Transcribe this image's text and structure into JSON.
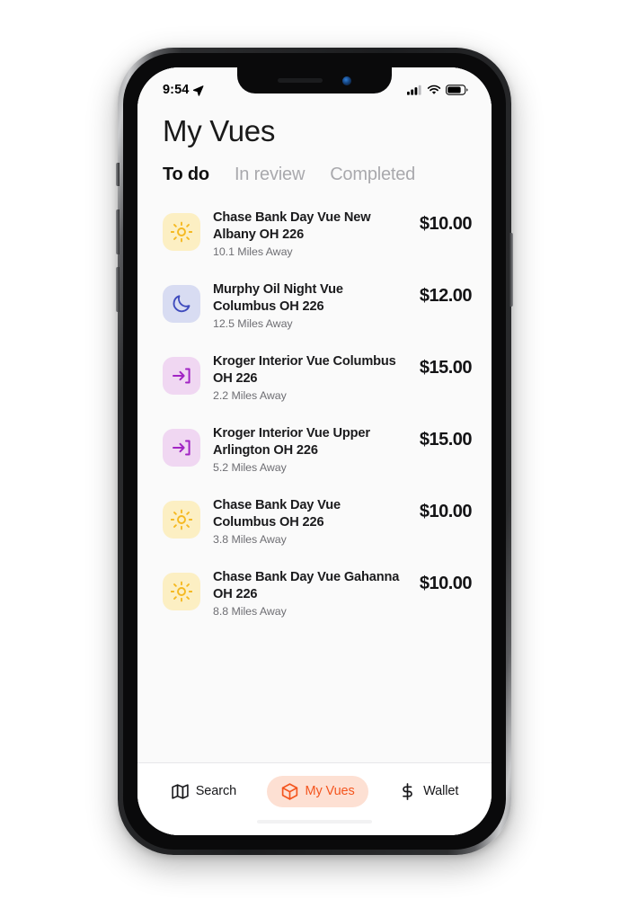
{
  "status_bar": {
    "time": "9:54",
    "location_icon": "location-arrow-icon",
    "cellular_icon": "cellular-bars-icon",
    "wifi_icon": "wifi-icon",
    "battery_icon": "battery-icon"
  },
  "header": {
    "title": "My Vues"
  },
  "tabs": [
    {
      "label": "To do",
      "active": true
    },
    {
      "label": "In review",
      "active": false
    },
    {
      "label": "Completed",
      "active": false
    }
  ],
  "list": {
    "items": [
      {
        "icon": "sun-icon",
        "icon_style": "sun",
        "title": "Chase Bank Day Vue New Albany OH 226",
        "distance": "10.1 Miles Away",
        "price": "$10.00"
      },
      {
        "icon": "moon-icon",
        "icon_style": "moon",
        "title": "Murphy Oil Night Vue Columbus OH 226",
        "distance": "12.5 Miles Away",
        "price": "$12.00"
      },
      {
        "icon": "enter-arrow-icon",
        "icon_style": "enter",
        "title": "Kroger Interior Vue Columbus OH 226",
        "distance": "2.2 Miles Away",
        "price": "$15.00"
      },
      {
        "icon": "enter-arrow-icon",
        "icon_style": "enter",
        "title": "Kroger Interior Vue Upper Arlington OH 226",
        "distance": "5.2 Miles Away",
        "price": "$15.00"
      },
      {
        "icon": "sun-icon",
        "icon_style": "sun",
        "title": "Chase Bank Day Vue Columbus OH 226",
        "distance": "3.8 Miles Away",
        "price": "$10.00"
      },
      {
        "icon": "sun-icon",
        "icon_style": "sun",
        "title": "Chase Bank Day Vue Gahanna OH 226",
        "distance": "8.8 Miles Away",
        "price": "$10.00"
      }
    ]
  },
  "bottom_nav": {
    "items": [
      {
        "label": "Search",
        "icon": "map-icon",
        "active": false
      },
      {
        "label": "My Vues",
        "icon": "cube-icon",
        "active": true
      },
      {
        "label": "Wallet",
        "icon": "dollar-icon",
        "active": false
      }
    ]
  },
  "colors": {
    "accent": "#f4551e",
    "accent_pill": "#fde0d3",
    "sun_bg": "#fcefc3",
    "sun_fg": "#f5b921",
    "moon_bg": "#d8dcf2",
    "moon_fg": "#3f4bbd",
    "enter_bg": "#f0d7f2",
    "enter_fg": "#a225c4",
    "content_bg": "#fafafa",
    "text_primary": "#1b1b1d",
    "text_muted": "#6e6e73"
  }
}
